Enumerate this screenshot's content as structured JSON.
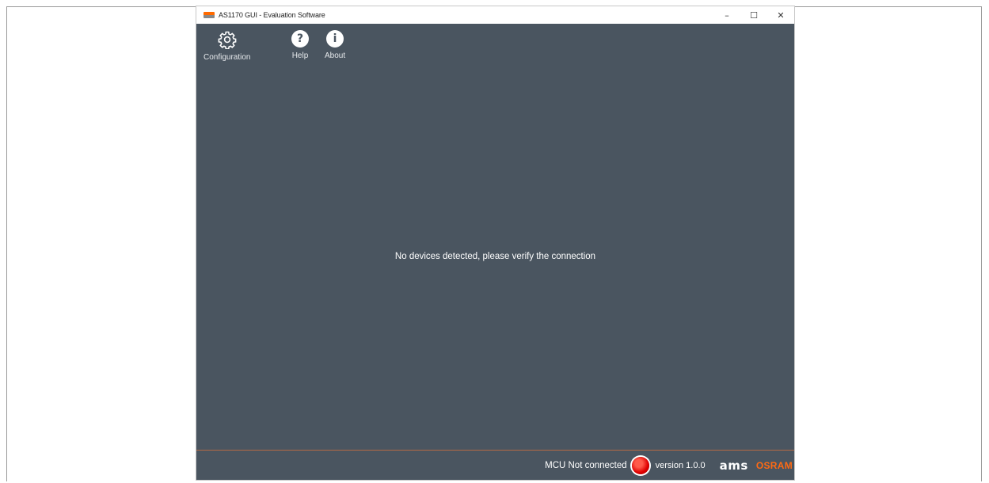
{
  "window": {
    "title": "AS1170 GUI - Evaluation Software",
    "controls": {
      "minimize": "–",
      "maximize": "☐",
      "close": "✕"
    }
  },
  "toolbar": {
    "items": [
      {
        "label": "Configuration",
        "icon": "gear-icon"
      },
      {
        "label": "Help",
        "icon": "help-icon",
        "glyph": "?"
      },
      {
        "label": "About",
        "icon": "info-icon",
        "glyph": "i"
      }
    ]
  },
  "main": {
    "message": "No devices detected, please verify the connection"
  },
  "status": {
    "connection": "MCU Not connected",
    "connection_color": "#e00000",
    "version": "version 1.0.0",
    "brand_ams": "ams",
    "brand_osram": "OSRAM"
  },
  "colors": {
    "background": "#4a5560",
    "accent": "#ff6a13",
    "divider": "#b56a45"
  }
}
